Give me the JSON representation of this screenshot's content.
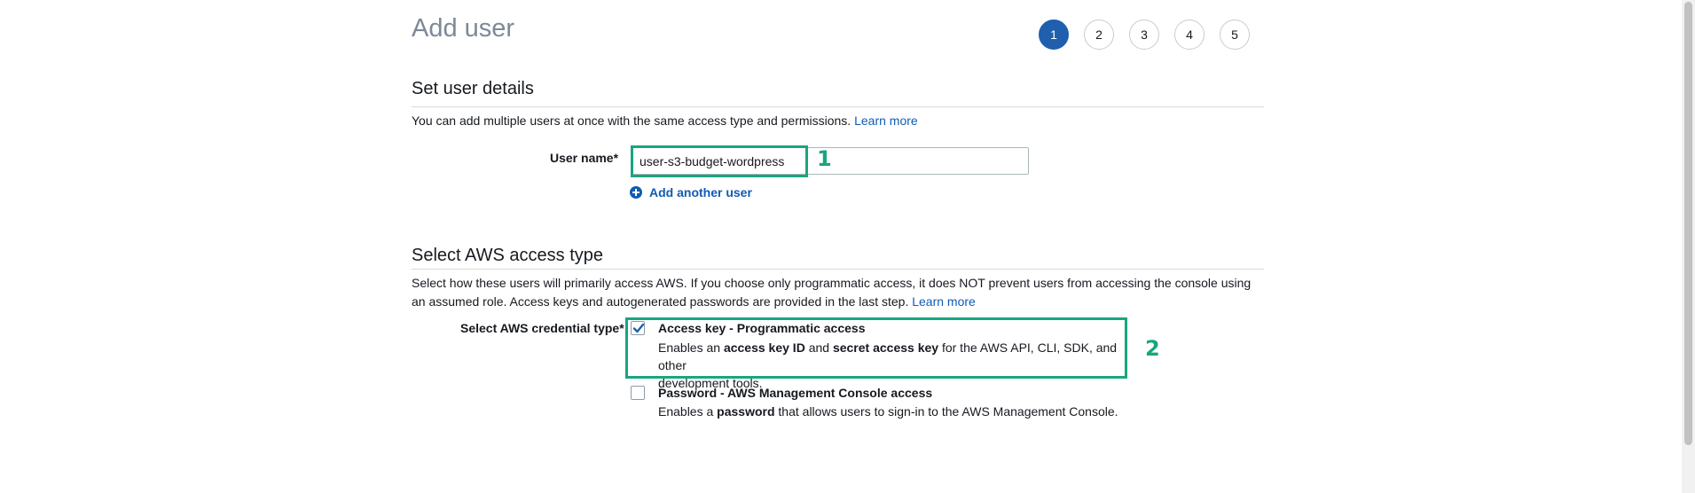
{
  "page": {
    "title": "Add user"
  },
  "steps": [
    {
      "label": "1",
      "active": true
    },
    {
      "label": "2",
      "active": false
    },
    {
      "label": "3",
      "active": false
    },
    {
      "label": "4",
      "active": false
    },
    {
      "label": "5",
      "active": false
    }
  ],
  "user_details": {
    "heading": "Set user details",
    "description": "You can add multiple users at once with the same access type and permissions.",
    "learn_more": "Learn more",
    "user_name_label": "User name*",
    "user_name_value": "user-s3-budget-wordpress",
    "add_another": "Add another user"
  },
  "access_type": {
    "heading": "Select AWS access type",
    "description_line1": "Select how these users will primarily access AWS. If you choose only programmatic access, it does NOT prevent users from accessing the console using",
    "description_line2": "an assumed role. Access keys and autogenerated passwords are provided in the last step.",
    "learn_more": "Learn more",
    "credential_label": "Select AWS credential type*",
    "options": [
      {
        "title": "Access key - Programmatic access",
        "checked": true,
        "desc_1": "Enables an ",
        "desc_2": "access key ID",
        "desc_3": " and ",
        "desc_4": "secret access key",
        "desc_5": " for the AWS API, CLI, SDK, and other",
        "desc_6": "development tools."
      },
      {
        "title": "Password - AWS Management Console access",
        "checked": false,
        "desc_1": "Enables a ",
        "desc_2": "password",
        "desc_3": " that allows users to sign-in to the AWS Management Console."
      }
    ]
  },
  "annotations": {
    "label_1": "1",
    "label_2": "2",
    "color": "#1aa57f"
  },
  "colors": {
    "accent": "#1f5fad",
    "link": "#0f5bb5",
    "title_gray": "#7d8998"
  },
  "icons": {
    "add": "plus-circle-icon",
    "check": "checkmark-icon"
  }
}
